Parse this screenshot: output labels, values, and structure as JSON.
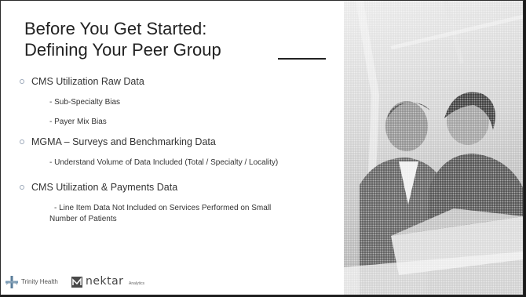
{
  "slide": {
    "title_line1": "Before You Get Started:",
    "title_line2": "Defining Your Peer Group"
  },
  "bullets": [
    {
      "label": "CMS Utilization Raw Data",
      "subs": [
        "- Sub-Specialty Bias",
        "- Payer Mix Bias"
      ]
    },
    {
      "label": "MGMA – Surveys and Benchmarking Data",
      "subs": [
        "- Understand Volume of Data Included (Total / Specialty / Locality)"
      ]
    },
    {
      "label": "CMS Utilization & Payments Data",
      "subs": [
        "- Line Item Data Not Included on Services Performed on Small",
        "Number of Patients"
      ]
    }
  ],
  "footer": {
    "logo1_text": "Trinity Health",
    "logo2_text": "nektar",
    "logo2_sub": "Analytics"
  },
  "colors": {
    "bullet_dot": "#9aa7b8",
    "text": "#333333",
    "background": "#ffffff"
  },
  "image": {
    "icon": "photo-two-business-people-at-laptop"
  }
}
